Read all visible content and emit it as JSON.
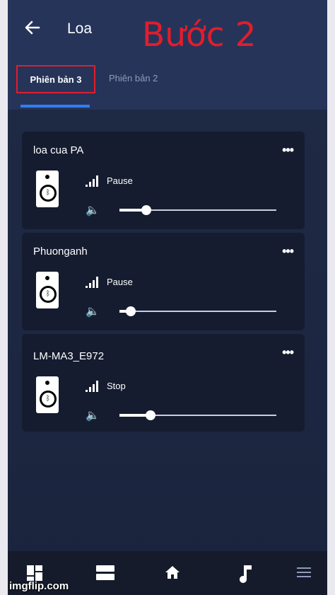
{
  "header": {
    "title": "Loa",
    "step_label": "Bước 2",
    "back_icon": "arrow-left-icon"
  },
  "tabs": [
    {
      "label": "Phiên bản 3",
      "active": true
    },
    {
      "label": "Phiên bản 2",
      "active": false
    }
  ],
  "speakers": [
    {
      "name": "loa cua PA",
      "status": "Pause",
      "volume": 0.17
    },
    {
      "name": "Phuonganh",
      "status": "Pause",
      "volume": 0.07
    },
    {
      "name": "LM-MA3_E972",
      "status": "Stop",
      "volume": 0.2
    }
  ],
  "more_label": "•••",
  "bottom_nav": [
    {
      "icon": "dashboard-icon"
    },
    {
      "icon": "list-icon"
    },
    {
      "icon": "home-icon"
    },
    {
      "icon": "music-note-icon",
      "active": true
    },
    {
      "icon": "menu-icon"
    }
  ],
  "watermark": "imgflip.com",
  "colors": {
    "accent": "#2f7ff1",
    "annotation": "#e21d2b",
    "background": "#1f2a44",
    "card": "#151c30"
  }
}
